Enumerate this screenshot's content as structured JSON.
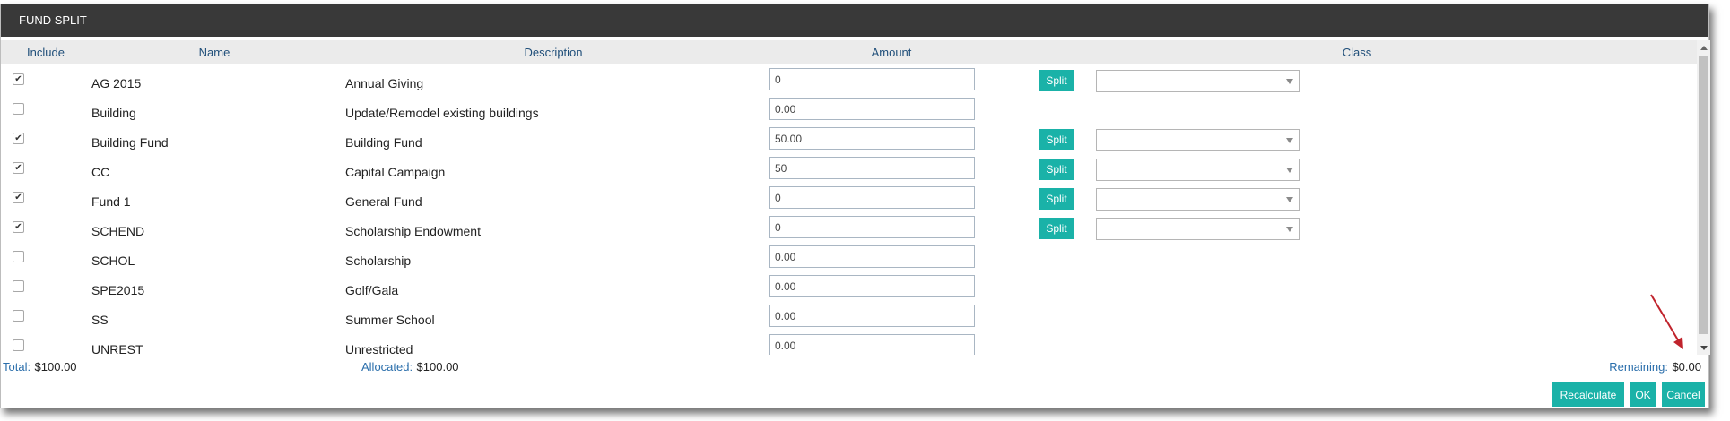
{
  "dialog": {
    "title": "FUND SPLIT"
  },
  "columns": {
    "include": "Include",
    "name": "Name",
    "description": "Description",
    "amount": "Amount",
    "class": "Class"
  },
  "rows": [
    {
      "checked": true,
      "name": "AG 2015",
      "description": "Annual Giving",
      "amount": "0",
      "split_label": "Split"
    },
    {
      "checked": false,
      "name": "Building",
      "description": "Update/Remodel existing buildings",
      "amount": "0.00",
      "split_label": ""
    },
    {
      "checked": true,
      "name": "Building Fund",
      "description": "Building Fund",
      "amount": "50.00",
      "split_label": "Split"
    },
    {
      "checked": true,
      "name": "CC",
      "description": "Capital Campaign",
      "amount": "50",
      "split_label": "Split"
    },
    {
      "checked": true,
      "name": "Fund 1",
      "description": "General Fund",
      "amount": "0",
      "split_label": "Split"
    },
    {
      "checked": true,
      "name": "SCHEND",
      "description": "Scholarship Endowment",
      "amount": "0",
      "split_label": "Split"
    },
    {
      "checked": false,
      "name": "SCHOL",
      "description": "Scholarship",
      "amount": "0.00",
      "split_label": ""
    },
    {
      "checked": false,
      "name": "SPE2015",
      "description": "Golf/Gala",
      "amount": "0.00",
      "split_label": ""
    },
    {
      "checked": false,
      "name": "SS",
      "description": "Summer School",
      "amount": "0.00",
      "split_label": ""
    },
    {
      "checked": false,
      "name": "UNREST",
      "description": "Unrestricted",
      "amount": "0.00",
      "split_label": ""
    }
  ],
  "footer": {
    "total_label": "Total:",
    "total_value": "$100.00",
    "allocated_label": "Allocated:",
    "allocated_value": "$100.00",
    "remaining_label": "Remaining:",
    "remaining_value": "$0.00"
  },
  "buttons": {
    "recalculate": "Recalculate",
    "ok": "OK",
    "cancel": "Cancel"
  },
  "colors": {
    "accent": "#1ab2a8",
    "titlebar": "#393939",
    "annotation_arrow": "#c0232c"
  }
}
